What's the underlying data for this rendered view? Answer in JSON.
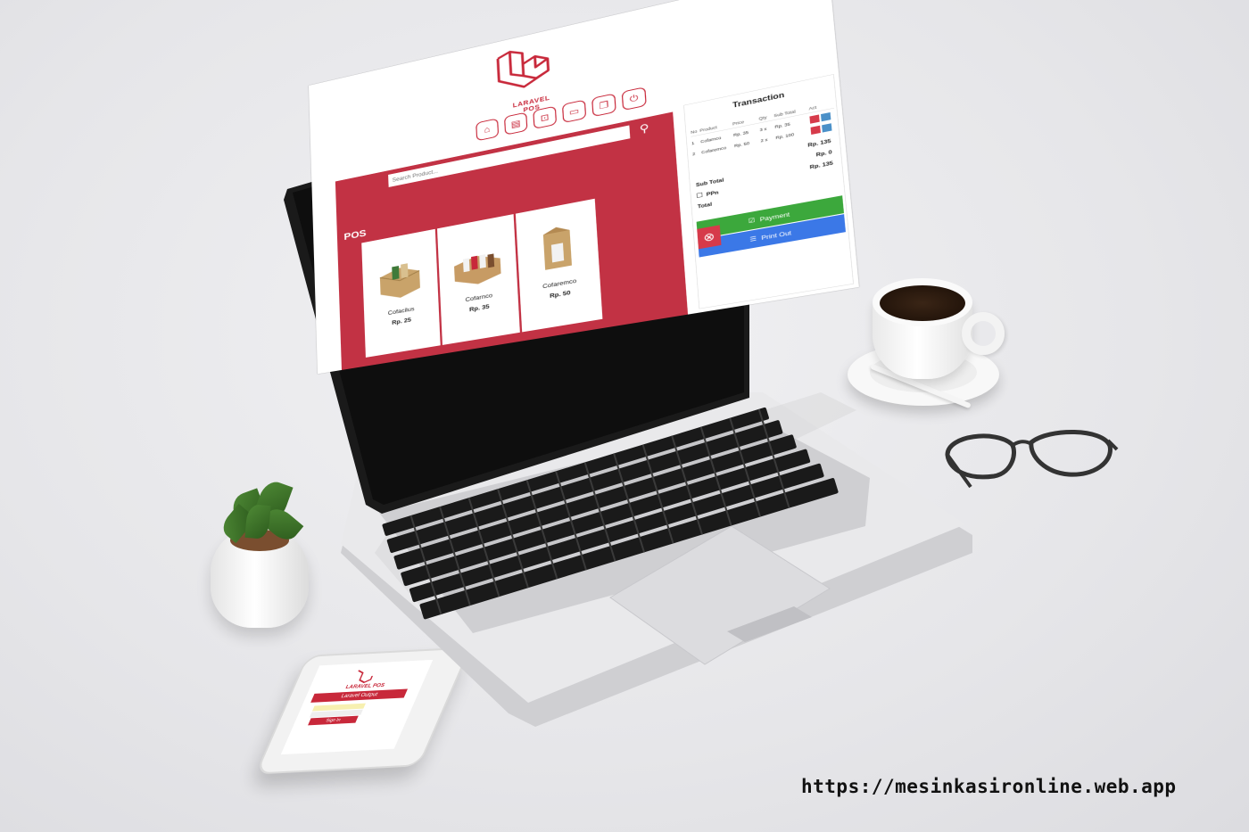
{
  "app": {
    "logo_text": "LARAVEL POS",
    "nav_icons": [
      "store-icon",
      "chart-icon",
      "cart-icon",
      "monitor-icon",
      "copy-icon",
      "power-icon"
    ]
  },
  "pos": {
    "title": "POS",
    "search_placeholder": "Search Product...",
    "products": [
      {
        "name": "Cofacilus",
        "price": "Rp. 25"
      },
      {
        "name": "Cofarnco",
        "price": "Rp. 35"
      },
      {
        "name": "Cofaremco",
        "price": "Rp. 50"
      }
    ]
  },
  "transaction": {
    "title": "Transaction",
    "columns": [
      "No",
      "Product",
      "Price",
      "Qty",
      "Sub Total",
      "Act"
    ],
    "rows": [
      {
        "no": "1",
        "product": "Cofarnco",
        "price": "Rp. 35",
        "qty": "3 x",
        "subtotal": "Rp. 35"
      },
      {
        "no": "2",
        "product": "Cofaremco",
        "price": "Rp. 50",
        "qty": "2 x",
        "subtotal": "Rp. 100"
      }
    ],
    "sub_total_label": "Sub Total",
    "sub_total_value": "Rp. 135",
    "ppn_label": "PPn",
    "ppn_value": "Rp. 0",
    "total_label": "Total",
    "total_value": "Rp. 135",
    "payment_label": "Payment",
    "print_label": "Print Out"
  },
  "phone": {
    "logo_text": "LARAVEL POS",
    "banner_text": "Laravel Output",
    "button_text": "Sign In"
  },
  "footer_url": "https://mesinkasironline.web.app",
  "colors": {
    "brand_red": "#c8283a",
    "panel_red": "#c23244",
    "payment_green": "#3ca83c",
    "print_blue": "#3b78e7"
  }
}
